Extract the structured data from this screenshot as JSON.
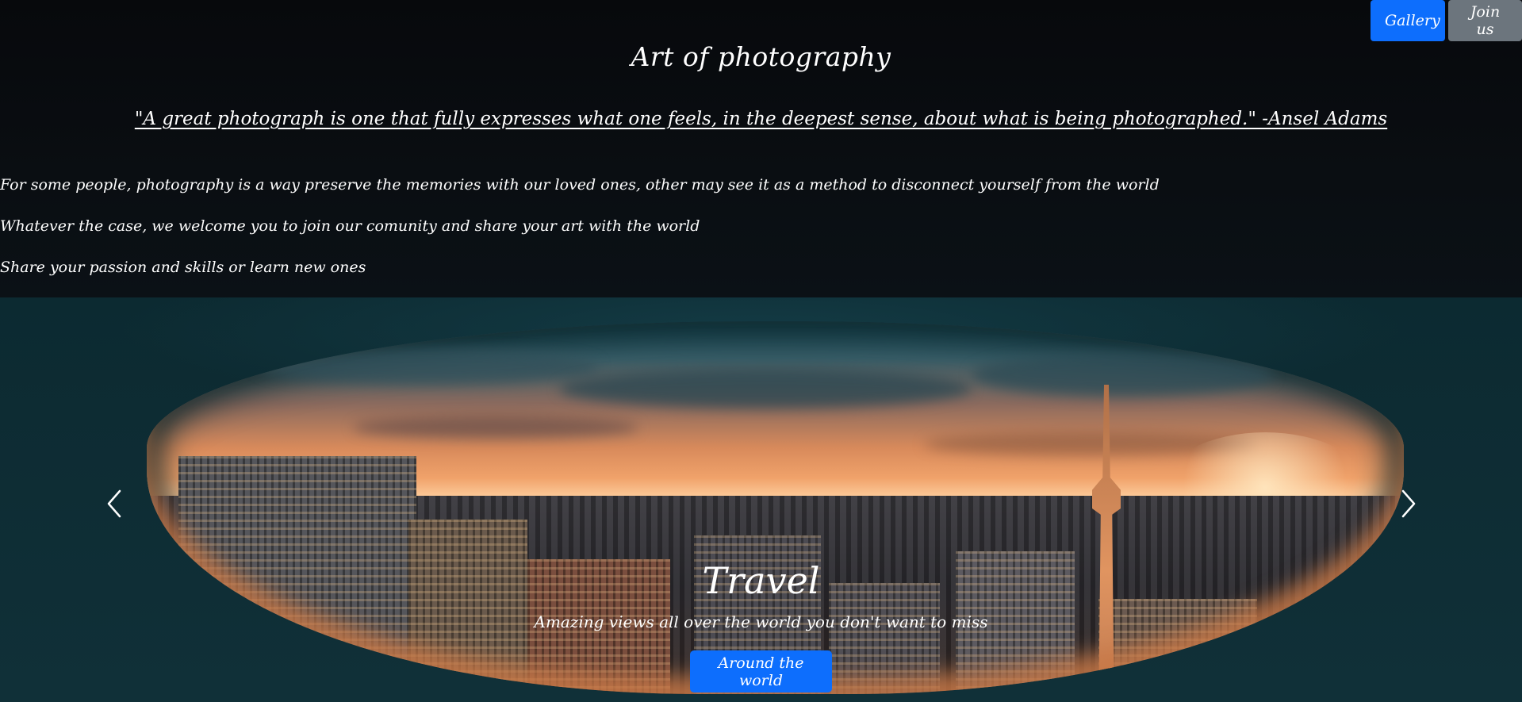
{
  "nav": {
    "gallery_label": "Gallery",
    "join_label": "Join us"
  },
  "header": {
    "title": "Art of photography",
    "quote": "\"A great photograph is one that fully expresses what one feels, in the deepest sense, about what is being photographed.\" -Ansel Adams"
  },
  "intro": {
    "lines": [
      "For some people, photography is a way preserve the memories with our loved ones, other may see it as a method to disconnect yourself from the world",
      "Whatever the case, we welcome you to join our comunity and share your art with the world",
      "Share your passion and skills or learn new ones"
    ]
  },
  "carousel": {
    "slide": {
      "title": "Travel",
      "text": "Amazing views all over the world you don't want to miss",
      "button_label": "Around the world"
    },
    "prev_icon": "chevron-left-icon",
    "next_icon": "chevron-right-icon"
  },
  "colors": {
    "primary": "#0d6efd",
    "secondary": "#6c757d",
    "background": "#0a0c0f"
  }
}
